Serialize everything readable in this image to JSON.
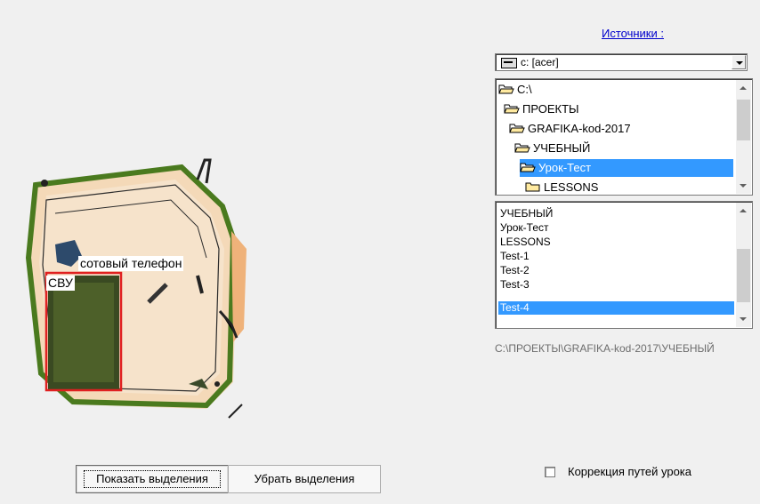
{
  "xray": {
    "label_phone": "сотовый телефон",
    "label_svu": "СВУ"
  },
  "sources": {
    "link_label": "Источники :"
  },
  "drive": {
    "value": "c: [acer]",
    "icon": "drive-icon"
  },
  "directories": {
    "items": [
      {
        "label": "C:\\",
        "icon": "open-folder-icon",
        "selected": false
      },
      {
        "label": "ПРОЕКТЫ",
        "icon": "open-folder-icon",
        "selected": false
      },
      {
        "label": "GRAFIKA-kod-2017",
        "icon": "open-folder-icon",
        "selected": false
      },
      {
        "label": "УЧЕБНЫЙ",
        "icon": "open-folder-icon",
        "selected": false
      },
      {
        "label": "Урок-Тест",
        "icon": "open-folder-icon",
        "selected": true
      },
      {
        "label": "LESSONS",
        "icon": "folder-icon",
        "selected": false
      }
    ]
  },
  "files": {
    "items": [
      {
        "label": "УЧЕБНЫЙ",
        "selected": false
      },
      {
        "label": "Урок-Тест",
        "selected": false
      },
      {
        "label": "LESSONS",
        "selected": false
      },
      {
        "label": "Test-1",
        "selected": false
      },
      {
        "label": "Test-2",
        "selected": false
      },
      {
        "label": "Test-3",
        "selected": false
      },
      {
        "label": "Test-4",
        "selected": true
      }
    ]
  },
  "path": "C:\\ПРОЕКТЫ\\GRAFIKA-kod-2017\\УЧЕБНЫЙ",
  "buttons": {
    "show": "Показать выделения",
    "hide": "Убрать выделения"
  },
  "checkbox": {
    "label": "Коррекция путей урока",
    "checked": false
  },
  "colors": {
    "selection": "#3399ff",
    "link": "#0000cc",
    "highlight_box": "#e02020"
  }
}
